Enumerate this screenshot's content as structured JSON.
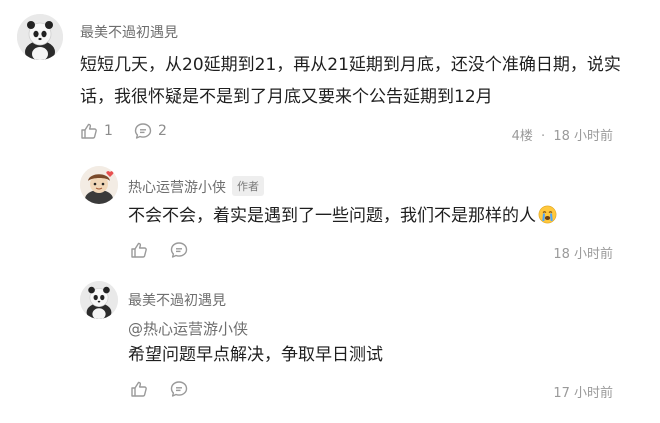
{
  "comment_main": {
    "username": "最美不過初遇見",
    "text_line1": "短短几天，从20延期到21，再从21延期到月底，还没个准确日期，说实",
    "text_line2": "话，我很怀疑是不是到了月底又要来个公告延期到12月",
    "like_count": "1",
    "reply_count": "2",
    "floor": "4楼",
    "separator": "·",
    "time": "18 小时前"
  },
  "reply_1": {
    "username": "热心运营游小侠",
    "badge": "作者",
    "text": "不会不会，着实是遇到了一些问题，我们不是那样的人",
    "emoji": "crying-face-icon",
    "time": "18 小时前"
  },
  "reply_2": {
    "username": "最美不過初遇見",
    "mention": "@热心运营游小侠",
    "text": "希望问题早点解决，争取早日测试",
    "time": "17 小时前"
  },
  "colors": {
    "background": "#ffffff",
    "text": "#1f1f1f",
    "muted": "#9a9a9a",
    "badge_bg": "#eeeeee"
  }
}
